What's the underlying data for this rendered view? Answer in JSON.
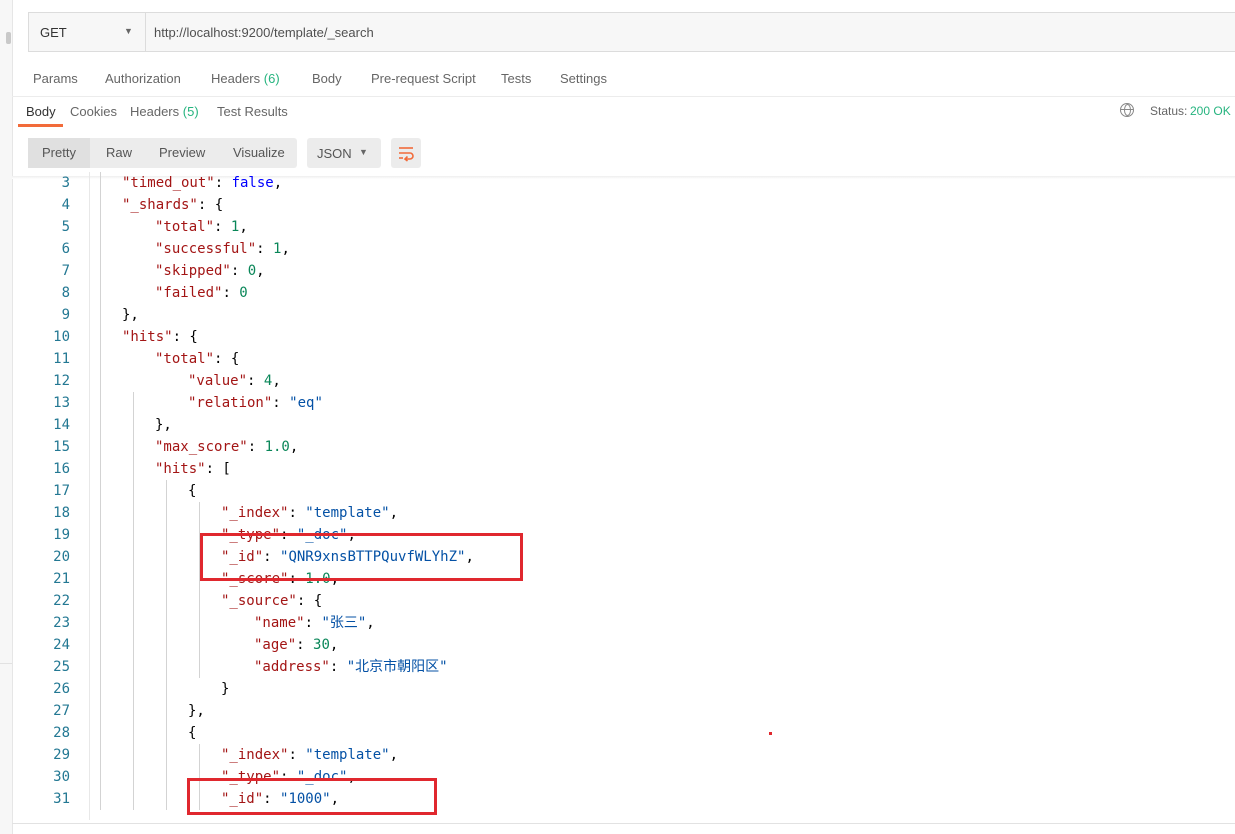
{
  "request": {
    "method": "GET",
    "url": "http://localhost:9200/template/_search",
    "tabs": [
      {
        "label": "Params",
        "count": ""
      },
      {
        "label": "Authorization",
        "count": ""
      },
      {
        "label": "Headers",
        "count": "(6)"
      },
      {
        "label": "Body",
        "count": ""
      },
      {
        "label": "Pre-request Script",
        "count": ""
      },
      {
        "label": "Tests",
        "count": ""
      },
      {
        "label": "Settings",
        "count": ""
      }
    ]
  },
  "response": {
    "tabs": [
      {
        "label": "Body",
        "count": ""
      },
      {
        "label": "Cookies",
        "count": ""
      },
      {
        "label": "Headers",
        "count": "(5)"
      },
      {
        "label": "Test Results",
        "count": ""
      }
    ],
    "active_tab": "Body",
    "status_label": "Status:",
    "status_value": "200 OK",
    "format_buttons": [
      "Pretty",
      "Raw",
      "Preview",
      "Visualize"
    ],
    "active_format": "Pretty",
    "language": "JSON",
    "wrap_icon": "wrap-lines-icon"
  },
  "colors": {
    "accent": "#f26b3a",
    "status_ok": "#26b47f",
    "highlight_box": "#e0282e",
    "json_key": "#a31515",
    "json_string": "#0451a5",
    "json_number": "#098658",
    "json_boolean": "#0000ff",
    "line_number": "#237893"
  },
  "code_lines": [
    {
      "n": "3",
      "indent": 1,
      "tokens": [
        {
          "t": "\"timed_out\"",
          "c": "k"
        },
        {
          "t": ": ",
          "c": "p"
        },
        {
          "t": "false",
          "c": "b"
        },
        {
          "t": ",",
          "c": "p"
        }
      ]
    },
    {
      "n": "4",
      "indent": 1,
      "tokens": [
        {
          "t": "\"_shards\"",
          "c": "k"
        },
        {
          "t": ": {",
          "c": "p"
        }
      ]
    },
    {
      "n": "5",
      "indent": 2,
      "tokens": [
        {
          "t": "\"total\"",
          "c": "k"
        },
        {
          "t": ": ",
          "c": "p"
        },
        {
          "t": "1",
          "c": "n"
        },
        {
          "t": ",",
          "c": "p"
        }
      ]
    },
    {
      "n": "6",
      "indent": 2,
      "tokens": [
        {
          "t": "\"successful\"",
          "c": "k"
        },
        {
          "t": ": ",
          "c": "p"
        },
        {
          "t": "1",
          "c": "n"
        },
        {
          "t": ",",
          "c": "p"
        }
      ]
    },
    {
      "n": "7",
      "indent": 2,
      "tokens": [
        {
          "t": "\"skipped\"",
          "c": "k"
        },
        {
          "t": ": ",
          "c": "p"
        },
        {
          "t": "0",
          "c": "n"
        },
        {
          "t": ",",
          "c": "p"
        }
      ]
    },
    {
      "n": "8",
      "indent": 2,
      "tokens": [
        {
          "t": "\"failed\"",
          "c": "k"
        },
        {
          "t": ": ",
          "c": "p"
        },
        {
          "t": "0",
          "c": "n"
        }
      ]
    },
    {
      "n": "9",
      "indent": 1,
      "tokens": [
        {
          "t": "},",
          "c": "p"
        }
      ]
    },
    {
      "n": "10",
      "indent": 1,
      "tokens": [
        {
          "t": "\"hits\"",
          "c": "k"
        },
        {
          "t": ": {",
          "c": "p"
        }
      ]
    },
    {
      "n": "11",
      "indent": 2,
      "tokens": [
        {
          "t": "\"total\"",
          "c": "k"
        },
        {
          "t": ": {",
          "c": "p"
        }
      ]
    },
    {
      "n": "12",
      "indent": 3,
      "tokens": [
        {
          "t": "\"value\"",
          "c": "k"
        },
        {
          "t": ": ",
          "c": "p"
        },
        {
          "t": "4",
          "c": "n"
        },
        {
          "t": ",",
          "c": "p"
        }
      ]
    },
    {
      "n": "13",
      "indent": 3,
      "tokens": [
        {
          "t": "\"relation\"",
          "c": "k"
        },
        {
          "t": ": ",
          "c": "p"
        },
        {
          "t": "\"eq\"",
          "c": "s"
        }
      ]
    },
    {
      "n": "14",
      "indent": 2,
      "tokens": [
        {
          "t": "},",
          "c": "p"
        }
      ]
    },
    {
      "n": "15",
      "indent": 2,
      "tokens": [
        {
          "t": "\"max_score\"",
          "c": "k"
        },
        {
          "t": ": ",
          "c": "p"
        },
        {
          "t": "1.0",
          "c": "n"
        },
        {
          "t": ",",
          "c": "p"
        }
      ]
    },
    {
      "n": "16",
      "indent": 2,
      "tokens": [
        {
          "t": "\"hits\"",
          "c": "k"
        },
        {
          "t": ": [",
          "c": "p"
        }
      ]
    },
    {
      "n": "17",
      "indent": 3,
      "tokens": [
        {
          "t": "{",
          "c": "p"
        }
      ]
    },
    {
      "n": "18",
      "indent": 4,
      "tokens": [
        {
          "t": "\"_index\"",
          "c": "k"
        },
        {
          "t": ": ",
          "c": "p"
        },
        {
          "t": "\"template\"",
          "c": "s"
        },
        {
          "t": ",",
          "c": "p"
        }
      ]
    },
    {
      "n": "19",
      "indent": 4,
      "tokens": [
        {
          "t": "\"_type\"",
          "c": "k"
        },
        {
          "t": ": ",
          "c": "p"
        },
        {
          "t": "\"_doc\"",
          "c": "s"
        },
        {
          "t": ",",
          "c": "p"
        }
      ]
    },
    {
      "n": "20",
      "indent": 4,
      "tokens": [
        {
          "t": "\"_id\"",
          "c": "k"
        },
        {
          "t": ": ",
          "c": "p"
        },
        {
          "t": "\"QNR9xnsBTTPQuvfWLYhZ\"",
          "c": "s"
        },
        {
          "t": ",",
          "c": "p"
        }
      ]
    },
    {
      "n": "21",
      "indent": 4,
      "tokens": [
        {
          "t": "\"_score\"",
          "c": "k"
        },
        {
          "t": ": ",
          "c": "p"
        },
        {
          "t": "1.0",
          "c": "n"
        },
        {
          "t": ",",
          "c": "p"
        }
      ]
    },
    {
      "n": "22",
      "indent": 4,
      "tokens": [
        {
          "t": "\"_source\"",
          "c": "k"
        },
        {
          "t": ": {",
          "c": "p"
        }
      ]
    },
    {
      "n": "23",
      "indent": 5,
      "tokens": [
        {
          "t": "\"name\"",
          "c": "k"
        },
        {
          "t": ": ",
          "c": "p"
        },
        {
          "t": "\"张三\"",
          "c": "s"
        },
        {
          "t": ",",
          "c": "p"
        }
      ]
    },
    {
      "n": "24",
      "indent": 5,
      "tokens": [
        {
          "t": "\"age\"",
          "c": "k"
        },
        {
          "t": ": ",
          "c": "p"
        },
        {
          "t": "30",
          "c": "n"
        },
        {
          "t": ",",
          "c": "p"
        }
      ]
    },
    {
      "n": "25",
      "indent": 5,
      "tokens": [
        {
          "t": "\"address\"",
          "c": "k"
        },
        {
          "t": ": ",
          "c": "p"
        },
        {
          "t": "\"北京市朝阳区\"",
          "c": "s"
        }
      ]
    },
    {
      "n": "26",
      "indent": 4,
      "tokens": [
        {
          "t": "}",
          "c": "p"
        }
      ]
    },
    {
      "n": "27",
      "indent": 3,
      "tokens": [
        {
          "t": "},",
          "c": "p"
        }
      ]
    },
    {
      "n": "28",
      "indent": 3,
      "tokens": [
        {
          "t": "{",
          "c": "p"
        }
      ]
    },
    {
      "n": "29",
      "indent": 4,
      "tokens": [
        {
          "t": "\"_index\"",
          "c": "k"
        },
        {
          "t": ": ",
          "c": "p"
        },
        {
          "t": "\"template\"",
          "c": "s"
        },
        {
          "t": ",",
          "c": "p"
        }
      ]
    },
    {
      "n": "30",
      "indent": 4,
      "tokens": [
        {
          "t": "\"_type\"",
          "c": "k"
        },
        {
          "t": ": ",
          "c": "p"
        },
        {
          "t": "\"_doc\"",
          "c": "s"
        },
        {
          "t": ",",
          "c": "p"
        }
      ]
    },
    {
      "n": "31",
      "indent": 4,
      "tokens": [
        {
          "t": "\"_id\"",
          "c": "k"
        },
        {
          "t": ": ",
          "c": "p"
        },
        {
          "t": "\"1000\"",
          "c": "s"
        },
        {
          "t": ",",
          "c": "p"
        }
      ]
    }
  ]
}
